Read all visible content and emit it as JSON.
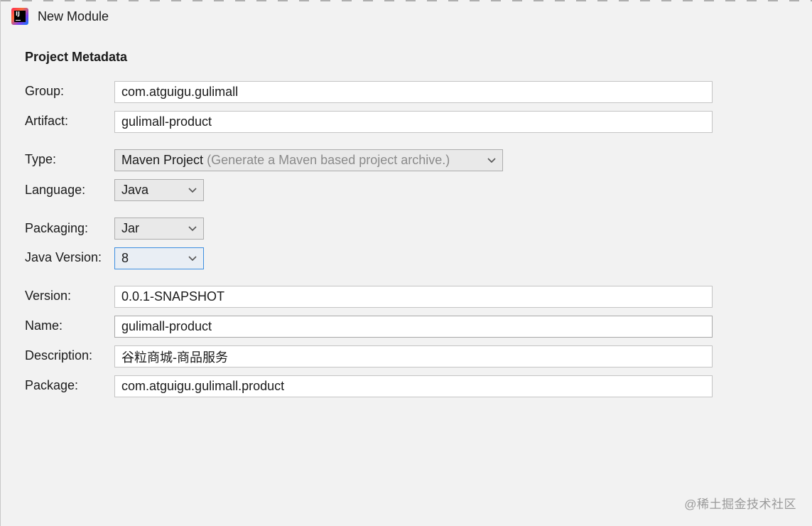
{
  "window": {
    "title": "New Module"
  },
  "section": {
    "title": "Project Metadata"
  },
  "form": {
    "group": {
      "label": "Group:",
      "value": "com.atguigu.gulimall"
    },
    "artifact": {
      "label": "Artifact:",
      "value": "gulimall-product"
    },
    "type": {
      "label": "Type:",
      "value": "Maven Project",
      "hint": "(Generate a Maven based project archive.)"
    },
    "language": {
      "label": "Language:",
      "value": "Java"
    },
    "packaging": {
      "label": "Packaging:",
      "value": "Jar"
    },
    "java_version": {
      "label": "Java Version:",
      "value": "8"
    },
    "version": {
      "label": "Version:",
      "value": "0.0.1-SNAPSHOT"
    },
    "name": {
      "label": "Name:",
      "value": "gulimall-product"
    },
    "description": {
      "label": "Description:",
      "value": "谷粒商城-商品服务"
    },
    "package": {
      "label": "Package:",
      "value": "com.atguigu.gulimall.product"
    }
  },
  "watermark": {
    "text": "@稀土掘金技术社区"
  },
  "icons": {
    "app": "intellij-idea-icon",
    "dropdown": "chevron-down-icon"
  },
  "colors": {
    "background": "#f2f2f2",
    "focus_border": "#3d8ee0",
    "hint_text": "#8a8a8a"
  }
}
